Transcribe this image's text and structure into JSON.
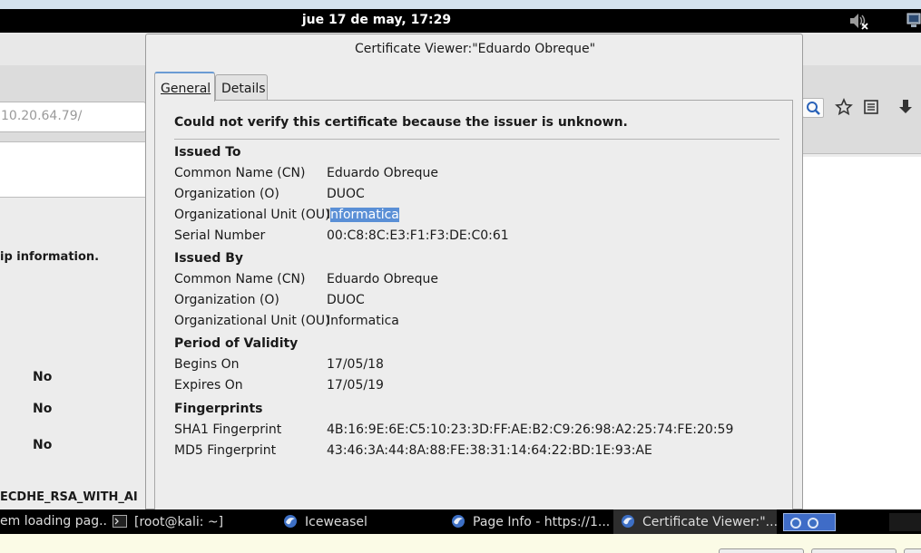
{
  "top_panel": {
    "clock": "jue 17 de may, 17:29"
  },
  "background_browser": {
    "url_fragment": "10.20.64.79/",
    "ownership_text": "ip information.",
    "no_values": [
      "No",
      "No",
      "No"
    ],
    "cipher_fragment": "ECDHE_RSA_WITH_AI"
  },
  "dialog": {
    "title": "Certificate Viewer:\"Eduardo Obreque\"",
    "tabs": [
      {
        "label": "General"
      },
      {
        "label": "Details"
      }
    ],
    "verify_message": "Could not verify this certificate because the issuer is unknown.",
    "issued_to": {
      "title": "Issued To",
      "rows": [
        {
          "label": "Common Name (CN)",
          "value": "Eduardo Obreque"
        },
        {
          "label": "Organization (O)",
          "value": "DUOC"
        },
        {
          "label": "Organizational Unit (OU)",
          "value_first": "I",
          "value_selected": "nformatica"
        },
        {
          "label": "Serial Number",
          "value": "00:C8:8C:E3:F1:F3:DE:C0:61"
        }
      ]
    },
    "issued_by": {
      "title": "Issued By",
      "rows": [
        {
          "label": "Common Name (CN)",
          "value": "Eduardo Obreque"
        },
        {
          "label": "Organization (O)",
          "value": "DUOC"
        },
        {
          "label": "Organizational Unit (OU)",
          "value": "Informatica"
        }
      ]
    },
    "validity": {
      "title": "Period of Validity",
      "rows": [
        {
          "label": "Begins On",
          "value": "17/05/18"
        },
        {
          "label": "Expires On",
          "value": "17/05/19"
        }
      ]
    },
    "fingerprints": {
      "title": "Fingerprints",
      "rows": [
        {
          "label": "SHA1 Fingerprint",
          "value": "4B:16:9E:6E:C5:10:23:3D:FF:AE:B2:C9:26:98:A2:25:74:FE:20:59"
        },
        {
          "label": "MD5 Fingerprint",
          "value": "43:46:3A:44:8A:88:FE:38:31:14:64:22:BD:1E:93:AE"
        }
      ]
    }
  },
  "taskbar": {
    "items": [
      {
        "label": "em loading pag..."
      },
      {
        "label": "[root@kali: ~]"
      },
      {
        "label": "Iceweasel"
      },
      {
        "label": "Page Info - https://1..."
      },
      {
        "label": "Certificate Viewer:\"..."
      }
    ]
  },
  "colors": {
    "selection": "#5a8fd6",
    "panel_bg": "#000000",
    "dialog_bg": "#ededed"
  },
  "icons": [
    "volume-muted-icon",
    "network-icon",
    "search-icon",
    "star-icon",
    "bookmarks-icon",
    "download-icon",
    "terminal-icon",
    "iceweasel-icon"
  ]
}
